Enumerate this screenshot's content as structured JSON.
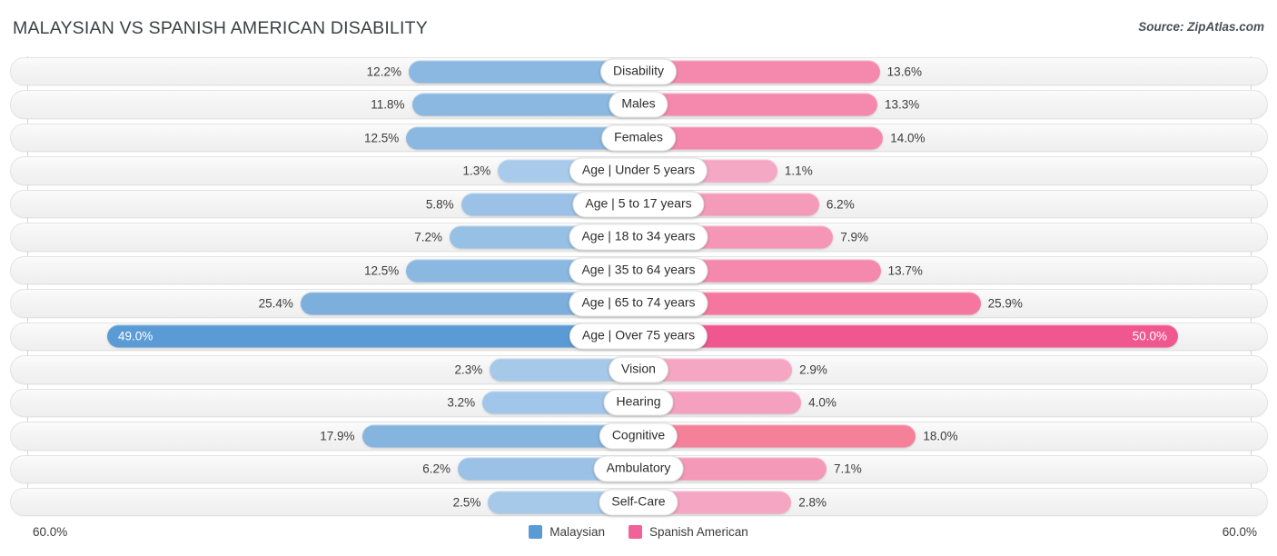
{
  "header": {
    "title": "MALAYSIAN VS SPANISH AMERICAN DISABILITY",
    "source": "Source: ZipAtlas.com"
  },
  "axis": {
    "left_label": "60.0%",
    "right_label": "60.0%",
    "max": 60.0
  },
  "legend": {
    "items": [
      {
        "label": "Malaysian",
        "color": "#5b9bd5"
      },
      {
        "label": "Spanish American",
        "color": "#f0629a"
      }
    ]
  },
  "chart_data": {
    "type": "bar",
    "orientation": "diverging-horizontal",
    "title": "MALAYSIAN VS SPANISH AMERICAN DISABILITY",
    "xlabel": "",
    "ylabel": "",
    "xlim": [
      60.0,
      60.0
    ],
    "grid": true,
    "legend_position": "bottom-center",
    "categories": [
      "Disability",
      "Males",
      "Females",
      "Age | Under 5 years",
      "Age | 5 to 17 years",
      "Age | 18 to 34 years",
      "Age | 35 to 64 years",
      "Age | 65 to 74 years",
      "Age | Over 75 years",
      "Vision",
      "Hearing",
      "Cognitive",
      "Ambulatory",
      "Self-Care"
    ],
    "series": [
      {
        "name": "Malaysian",
        "color": "#5b9bd5",
        "values": [
          12.2,
          11.8,
          12.5,
          1.3,
          5.8,
          7.2,
          12.5,
          25.4,
          49.0,
          2.3,
          3.2,
          17.9,
          6.2,
          2.5
        ],
        "labels": [
          "12.2%",
          "11.8%",
          "12.5%",
          "1.3%",
          "5.8%",
          "7.2%",
          "12.5%",
          "25.4%",
          "49.0%",
          "2.3%",
          "3.2%",
          "17.9%",
          "6.2%",
          "2.5%"
        ]
      },
      {
        "name": "Spanish American",
        "color": "#f0629a",
        "values": [
          13.6,
          13.3,
          14.0,
          1.1,
          6.2,
          7.9,
          13.7,
          25.9,
          50.0,
          2.9,
          4.0,
          18.0,
          7.1,
          2.8
        ],
        "labels": [
          "13.6%",
          "13.3%",
          "14.0%",
          "1.1%",
          "6.2%",
          "7.9%",
          "13.7%",
          "25.9%",
          "50.0%",
          "2.9%",
          "4.0%",
          "18.0%",
          "7.1%",
          "2.8%"
        ]
      }
    ]
  },
  "rows": [
    {
      "label": "Disability",
      "left_value": "12.2%",
      "right_value": "13.6%",
      "left_num": 12.2,
      "right_num": 13.6,
      "left_color": "#8bb8e0",
      "right_color": "#f589ad"
    },
    {
      "label": "Males",
      "left_value": "11.8%",
      "right_value": "13.3%",
      "left_num": 11.8,
      "right_num": 13.3,
      "left_color": "#8bb8e0",
      "right_color": "#f589ad"
    },
    {
      "label": "Females",
      "left_value": "12.5%",
      "right_value": "14.0%",
      "left_num": 12.5,
      "right_num": 14.0,
      "left_color": "#8bb8e0",
      "right_color": "#f589ad"
    },
    {
      "label": "Age | Under 5 years",
      "left_value": "1.3%",
      "right_value": "1.1%",
      "left_num": 1.3,
      "right_num": 1.1,
      "left_color": "#a9cbeb",
      "right_color": "#f5a8c4"
    },
    {
      "label": "Age | 5 to 17 years",
      "left_value": "5.8%",
      "right_value": "6.2%",
      "left_num": 5.8,
      "right_num": 6.2,
      "left_color": "#9bc2e6",
      "right_color": "#f59bba"
    },
    {
      "label": "Age | 18 to 34 years",
      "left_value": "7.2%",
      "right_value": "7.9%",
      "left_num": 7.2,
      "right_num": 7.9,
      "left_color": "#97c0e5",
      "right_color": "#f596b6"
    },
    {
      "label": "Age | 35 to 64 years",
      "left_value": "12.5%",
      "right_value": "13.7%",
      "left_num": 12.5,
      "right_num": 13.7,
      "left_color": "#8bb8e0",
      "right_color": "#f589ad"
    },
    {
      "label": "Age | 65 to 74 years",
      "left_value": "25.4%",
      "right_value": "25.9%",
      "left_num": 25.4,
      "right_num": 25.9,
      "left_color": "#7cafdc",
      "right_color": "#f5779f"
    },
    {
      "label": "Age | Over 75 years",
      "left_value": "49.0%",
      "right_value": "50.0%",
      "left_num": 49.0,
      "right_num": 50.0,
      "left_color": "#5b9bd5",
      "right_color": "#f0578f"
    },
    {
      "label": "Vision",
      "left_value": "2.3%",
      "right_value": "2.9%",
      "left_num": 2.3,
      "right_num": 2.9,
      "left_color": "#a6c9ea",
      "right_color": "#f5a6c2"
    },
    {
      "label": "Hearing",
      "left_value": "3.2%",
      "right_value": "4.0%",
      "left_num": 3.2,
      "right_num": 4.0,
      "left_color": "#a2c6e9",
      "right_color": "#f5a0bf"
    },
    {
      "label": "Cognitive",
      "left_value": "17.9%",
      "right_value": "18.0%",
      "left_num": 17.9,
      "right_num": 18.0,
      "left_color": "#85b4de",
      "right_color": "#f58099"
    },
    {
      "label": "Ambulatory",
      "left_value": "6.2%",
      "right_value": "7.1%",
      "left_num": 6.2,
      "right_num": 7.1,
      "left_color": "#9bc2e6",
      "right_color": "#f599b8"
    },
    {
      "label": "Self-Care",
      "left_value": "2.5%",
      "right_value": "2.8%",
      "left_num": 2.5,
      "right_num": 2.8,
      "left_color": "#a6c9ea",
      "right_color": "#f5a6c2"
    }
  ]
}
